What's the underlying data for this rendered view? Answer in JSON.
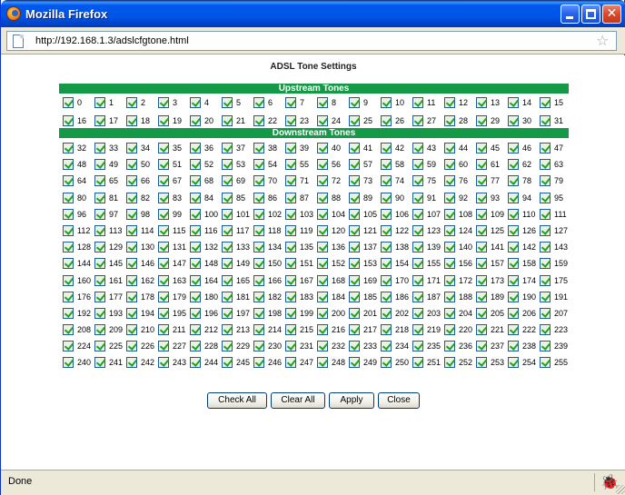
{
  "window": {
    "title": "Mozilla Firefox",
    "app_icon": "firefox-icon",
    "controls": {
      "minimize": "minimize-icon",
      "maximize": "maximize-icon",
      "close": "close-icon",
      "close_glyph": "✕"
    }
  },
  "urlbar": {
    "url": "http://192.168.1.3/adslcfgtone.html",
    "page_icon": "page-icon",
    "bookmark_icon": "star-icon"
  },
  "page": {
    "title": "ADSL Tone Settings",
    "upstream_label": "Upstream Tones",
    "downstream_label": "Downstream Tones",
    "upstream_range": [
      0,
      31
    ],
    "downstream_range": [
      32,
      255
    ],
    "all_tones_checked": true,
    "buttons": {
      "check_all": "Check All",
      "clear_all": "Clear All",
      "apply": "Apply",
      "close": "Close"
    }
  },
  "statusbar": {
    "text": "Done",
    "icon": "bug-icon"
  },
  "colors": {
    "section_bar": "#149a47",
    "titlebar": "#0055e5",
    "chrome": "#ece9d8"
  }
}
